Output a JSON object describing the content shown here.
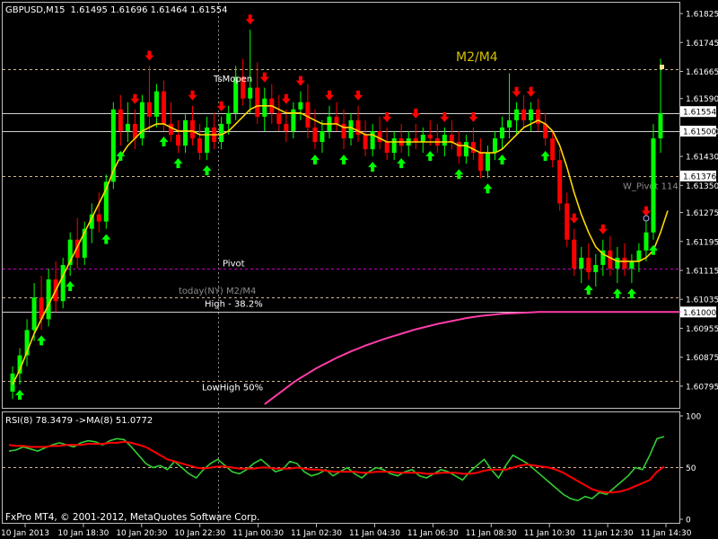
{
  "header": {
    "symbol": "GBPUSD,M15",
    "ohlc": "1.61495 1.61696 1.61464 1.61554"
  },
  "footer": {
    "copyright": "FxPro MT4, © 2001-2012, MetaQuotes Software Corp."
  },
  "colors": {
    "background": "#000000",
    "bull": "#00ff00",
    "bear": "#ff0000",
    "ma_fast": "#ffd700",
    "ma_slow": "#ff3da8",
    "rsi_line": "#32cd32",
    "rsi_ma": "#ff0000",
    "pivot": "#c000c0",
    "level": "#d2b48c",
    "white_line": "#d0d0d0",
    "axis_text": "#ffffff"
  },
  "chart_data": {
    "type": "candlestick",
    "x_ticks": [
      "10 Jan 2013",
      "10 Jan 18:30",
      "10 Jan 20:30",
      "10 Jan 22:30",
      "11 Jan 00:30",
      "11 Jan 02:30",
      "11 Jan 04:30",
      "11 Jan 06:30",
      "11 Jan 08:30",
      "11 Jan 10:30",
      "11 Jan 12:30",
      "11 Jan 14:30"
    ],
    "y_range": [
      1.6074,
      1.6185
    ],
    "y_ticks": [
      "1.61825",
      "1.61745",
      "1.61665",
      "1.61590",
      "1.61500",
      "1.61430",
      "1.61350",
      "1.61275",
      "1.61195",
      "1.61115",
      "1.61035",
      "1.60955",
      "1.60875",
      "1.60795"
    ],
    "price_tags": [
      {
        "label": "1.61554",
        "value": 1.61554
      },
      {
        "label": "1.61500",
        "value": 1.615
      },
      {
        "label": "1.61376",
        "value": 1.61376
      },
      {
        "label": "1.61000",
        "value": 1.61
      }
    ],
    "hlines": [
      {
        "value": 1.6167,
        "style": "level",
        "label": "M2/M4"
      },
      {
        "value": 1.6155,
        "style": "white",
        "label": ""
      },
      {
        "value": 1.615,
        "style": "white",
        "label": ""
      },
      {
        "value": 1.61376,
        "style": "level",
        "label": "W_Pivot 114"
      },
      {
        "value": 1.6112,
        "style": "pivot",
        "label": "Pivot"
      },
      {
        "value": 1.6104,
        "style": "level",
        "label": "High - 38.2%"
      },
      {
        "value": 1.61,
        "style": "white",
        "label": ""
      },
      {
        "value": 1.6081,
        "style": "level",
        "label": "LowHigh 50%"
      }
    ],
    "annotations": [
      {
        "text": "M2/M4",
        "color": "#d4c000"
      },
      {
        "text": "TsMopen",
        "color": "#ffffff"
      },
      {
        "text": "today(NY) M2/M4",
        "color": "#8c8c8c"
      }
    ],
    "candles": [
      [
        1.6078,
        1.6085,
        1.6076,
        1.6083
      ],
      [
        1.6083,
        1.609,
        1.608,
        1.6088
      ],
      [
        1.6088,
        1.6098,
        1.6085,
        1.6095
      ],
      [
        1.6095,
        1.6108,
        1.6092,
        1.6104
      ],
      [
        1.6104,
        1.611,
        1.6095,
        1.6098
      ],
      [
        1.6098,
        1.6112,
        1.6096,
        1.6109
      ],
      [
        1.6109,
        1.6114,
        1.61,
        1.6103
      ],
      [
        1.6103,
        1.6115,
        1.6101,
        1.6113
      ],
      [
        1.6113,
        1.6122,
        1.611,
        1.612
      ],
      [
        1.612,
        1.6126,
        1.6112,
        1.6115
      ],
      [
        1.6115,
        1.6125,
        1.6113,
        1.6123
      ],
      [
        1.6123,
        1.613,
        1.6119,
        1.6127
      ],
      [
        1.6127,
        1.6133,
        1.6122,
        1.6125
      ],
      [
        1.6125,
        1.6138,
        1.6123,
        1.6136
      ],
      [
        1.6136,
        1.6158,
        1.6134,
        1.6156
      ],
      [
        1.6156,
        1.616,
        1.6146,
        1.615
      ],
      [
        1.615,
        1.6158,
        1.6147,
        1.6152
      ],
      [
        1.6152,
        1.6156,
        1.6145,
        1.6148
      ],
      [
        1.6148,
        1.616,
        1.6146,
        1.6158
      ],
      [
        1.6158,
        1.6168,
        1.615,
        1.6154
      ],
      [
        1.6154,
        1.6163,
        1.6151,
        1.6161
      ],
      [
        1.6161,
        1.6164,
        1.615,
        1.6152
      ],
      [
        1.6152,
        1.6158,
        1.6147,
        1.6149
      ],
      [
        1.6149,
        1.6153,
        1.6144,
        1.6146
      ],
      [
        1.6146,
        1.6155,
        1.6144,
        1.6153
      ],
      [
        1.6153,
        1.6157,
        1.6146,
        1.6148
      ],
      [
        1.6148,
        1.6152,
        1.6142,
        1.6144
      ],
      [
        1.6144,
        1.6154,
        1.6142,
        1.6151
      ],
      [
        1.6151,
        1.6155,
        1.6145,
        1.6147
      ],
      [
        1.6147,
        1.6154,
        1.6145,
        1.6152
      ],
      [
        1.6152,
        1.6157,
        1.6149,
        1.6155
      ],
      [
        1.6155,
        1.6168,
        1.6153,
        1.6165
      ],
      [
        1.6165,
        1.617,
        1.6157,
        1.6159
      ],
      [
        1.6159,
        1.6178,
        1.6155,
        1.6162
      ],
      [
        1.6162,
        1.6169,
        1.6152,
        1.6154
      ],
      [
        1.6154,
        1.6162,
        1.615,
        1.6159
      ],
      [
        1.6159,
        1.6163,
        1.6152,
        1.6155
      ],
      [
        1.6155,
        1.616,
        1.615,
        1.6152
      ],
      [
        1.6152,
        1.6156,
        1.6147,
        1.615
      ],
      [
        1.615,
        1.6158,
        1.6148,
        1.6156
      ],
      [
        1.6156,
        1.6161,
        1.6153,
        1.6158
      ],
      [
        1.6158,
        1.6163,
        1.6148,
        1.6151
      ],
      [
        1.6151,
        1.6156,
        1.6145,
        1.6147
      ],
      [
        1.6147,
        1.6153,
        1.6144,
        1.615
      ],
      [
        1.615,
        1.6157,
        1.6148,
        1.6154
      ],
      [
        1.6154,
        1.6158,
        1.615,
        1.6152
      ],
      [
        1.6152,
        1.6156,
        1.6145,
        1.6148
      ],
      [
        1.6148,
        1.6155,
        1.6146,
        1.6153
      ],
      [
        1.6153,
        1.6157,
        1.6147,
        1.6149
      ],
      [
        1.6149,
        1.6153,
        1.6143,
        1.6145
      ],
      [
        1.6145,
        1.6152,
        1.6143,
        1.615
      ],
      [
        1.615,
        1.6154,
        1.6145,
        1.6147
      ],
      [
        1.6147,
        1.6151,
        1.6142,
        1.6144
      ],
      [
        1.6144,
        1.615,
        1.6142,
        1.6148
      ],
      [
        1.6148,
        1.6152,
        1.6144,
        1.6146
      ],
      [
        1.6146,
        1.615,
        1.6143,
        1.6148
      ],
      [
        1.6148,
        1.6152,
        1.6145,
        1.6147
      ],
      [
        1.6147,
        1.6151,
        1.6144,
        1.6149
      ],
      [
        1.6149,
        1.6153,
        1.6146,
        1.6148
      ],
      [
        1.6148,
        1.6152,
        1.6144,
        1.6146
      ],
      [
        1.6146,
        1.6151,
        1.6143,
        1.6149
      ],
      [
        1.6149,
        1.6153,
        1.6145,
        1.6147
      ],
      [
        1.6147,
        1.615,
        1.6141,
        1.6143
      ],
      [
        1.6143,
        1.6149,
        1.6141,
        1.6147
      ],
      [
        1.6147,
        1.6151,
        1.6142,
        1.6144
      ],
      [
        1.6144,
        1.6148,
        1.6137,
        1.6139
      ],
      [
        1.6139,
        1.6146,
        1.6137,
        1.6144
      ],
      [
        1.6144,
        1.615,
        1.6142,
        1.6148
      ],
      [
        1.6148,
        1.6154,
        1.6145,
        1.6151
      ],
      [
        1.6151,
        1.6166,
        1.6148,
        1.6153
      ],
      [
        1.6153,
        1.6158,
        1.6149,
        1.6156
      ],
      [
        1.6156,
        1.616,
        1.6151,
        1.6153
      ],
      [
        1.6153,
        1.6158,
        1.615,
        1.6156
      ],
      [
        1.6156,
        1.6159,
        1.615,
        1.6152
      ],
      [
        1.6152,
        1.6155,
        1.6146,
        1.6148
      ],
      [
        1.6148,
        1.615,
        1.614,
        1.6142
      ],
      [
        1.6142,
        1.6145,
        1.6128,
        1.613
      ],
      [
        1.613,
        1.6133,
        1.6118,
        1.612
      ],
      [
        1.612,
        1.6123,
        1.611,
        1.6112
      ],
      [
        1.6112,
        1.6118,
        1.6108,
        1.6115
      ],
      [
        1.6115,
        1.6119,
        1.6109,
        1.6111
      ],
      [
        1.6111,
        1.6116,
        1.6107,
        1.6113
      ],
      [
        1.6113,
        1.612,
        1.611,
        1.6117
      ],
      [
        1.6117,
        1.6121,
        1.611,
        1.6112
      ],
      [
        1.6112,
        1.6118,
        1.6108,
        1.6115
      ],
      [
        1.6115,
        1.6119,
        1.611,
        1.6112
      ],
      [
        1.6112,
        1.6116,
        1.6108,
        1.6114
      ],
      [
        1.6114,
        1.6119,
        1.6111,
        1.6117
      ],
      [
        1.6117,
        1.6125,
        1.6114,
        1.6122
      ],
      [
        1.6122,
        1.6152,
        1.612,
        1.6148
      ],
      [
        1.6148,
        1.617,
        1.6144,
        1.6155
      ]
    ],
    "ma_fast": [
      1.608,
      1.6084,
      1.6089,
      1.6094,
      1.6098,
      1.6102,
      1.6106,
      1.611,
      1.6114,
      1.6118,
      1.6122,
      1.6126,
      1.613,
      1.6134,
      1.6139,
      1.6143,
      1.6146,
      1.6148,
      1.615,
      1.6151,
      1.6152,
      1.6152,
      1.6151,
      1.615,
      1.615,
      1.615,
      1.6149,
      1.6149,
      1.6149,
      1.6149,
      1.615,
      1.6152,
      1.6154,
      1.6156,
      1.6157,
      1.6157,
      1.6157,
      1.6156,
      1.6155,
      1.6155,
      1.6155,
      1.6154,
      1.6153,
      1.6152,
      1.6152,
      1.6152,
      1.6151,
      1.6151,
      1.615,
      1.6149,
      1.6149,
      1.6148,
      1.6147,
      1.6147,
      1.6147,
      1.6147,
      1.6147,
      1.6147,
      1.6147,
      1.6147,
      1.6147,
      1.6147,
      1.6146,
      1.6146,
      1.6145,
      1.6144,
      1.6144,
      1.6144,
      1.6145,
      1.6147,
      1.6149,
      1.6151,
      1.6152,
      1.6153,
      1.6152,
      1.615,
      1.6146,
      1.614,
      1.6133,
      1.6127,
      1.6122,
      1.6118,
      1.6116,
      1.6115,
      1.6114,
      1.6114,
      1.6114,
      1.6114,
      1.6115,
      1.6117,
      1.6122,
      1.6128
    ],
    "ma_slow": [
      null,
      null,
      null,
      null,
      null,
      null,
      null,
      null,
      null,
      null,
      null,
      null,
      null,
      null,
      null,
      null,
      null,
      null,
      null,
      null,
      null,
      null,
      null,
      null,
      null,
      null,
      null,
      null,
      null,
      null,
      null,
      null,
      null,
      null,
      null,
      1.60745,
      1.6076,
      1.60775,
      1.6079,
      1.60805,
      1.60818,
      1.6083,
      1.60842,
      1.60853,
      1.60863,
      1.60873,
      1.60882,
      1.60891,
      1.60899,
      1.60907,
      1.60914,
      1.60921,
      1.60928,
      1.60934,
      1.6094,
      1.60946,
      1.60952,
      1.60957,
      1.60962,
      1.60967,
      1.60971,
      1.60975,
      1.60979,
      1.60983,
      1.60986,
      1.60989,
      1.60991,
      1.60993,
      1.60995,
      1.60996,
      1.60997,
      1.60998,
      1.60999,
      1.61,
      1.61,
      1.61,
      1.61,
      1.61,
      1.61,
      1.61,
      1.61,
      1.61,
      1.61,
      1.61,
      1.61,
      1.61,
      1.61,
      1.61,
      1.61,
      1.61,
      1.61,
      1.61,
      1.61,
      1.61
    ],
    "signals": [
      {
        "i": 1,
        "dir": "up"
      },
      {
        "i": 4,
        "dir": "up"
      },
      {
        "i": 8,
        "dir": "up"
      },
      {
        "i": 13,
        "dir": "up"
      },
      {
        "i": 15,
        "dir": "up"
      },
      {
        "i": 17,
        "dir": "down"
      },
      {
        "i": 19,
        "dir": "down"
      },
      {
        "i": 21,
        "dir": "up"
      },
      {
        "i": 23,
        "dir": "up"
      },
      {
        "i": 25,
        "dir": "down"
      },
      {
        "i": 27,
        "dir": "up"
      },
      {
        "i": 29,
        "dir": "down"
      },
      {
        "i": 33,
        "dir": "down"
      },
      {
        "i": 35,
        "dir": "down"
      },
      {
        "i": 38,
        "dir": "down"
      },
      {
        "i": 40,
        "dir": "down"
      },
      {
        "i": 42,
        "dir": "up"
      },
      {
        "i": 44,
        "dir": "down"
      },
      {
        "i": 46,
        "dir": "up"
      },
      {
        "i": 48,
        "dir": "down"
      },
      {
        "i": 50,
        "dir": "up"
      },
      {
        "i": 52,
        "dir": "down"
      },
      {
        "i": 54,
        "dir": "up"
      },
      {
        "i": 56,
        "dir": "down"
      },
      {
        "i": 58,
        "dir": "up"
      },
      {
        "i": 60,
        "dir": "down"
      },
      {
        "i": 62,
        "dir": "up"
      },
      {
        "i": 64,
        "dir": "down"
      },
      {
        "i": 66,
        "dir": "up"
      },
      {
        "i": 68,
        "dir": "up"
      },
      {
        "i": 70,
        "dir": "down"
      },
      {
        "i": 72,
        "dir": "down"
      },
      {
        "i": 74,
        "dir": "up"
      },
      {
        "i": 78,
        "dir": "down"
      },
      {
        "i": 80,
        "dir": "up"
      },
      {
        "i": 82,
        "dir": "down"
      },
      {
        "i": 84,
        "dir": "up"
      },
      {
        "i": 86,
        "dir": "up"
      },
      {
        "i": 88,
        "dir": "down"
      },
      {
        "i": 89,
        "dir": "up"
      },
      {
        "i": 91,
        "dir": "up"
      }
    ],
    "rsi": {
      "label": "RSI(8) 78.3479  ->MA(8) 51.0772",
      "y_range": [
        0,
        100
      ],
      "y_ticks": [
        "100",
        "50",
        "0"
      ],
      "level": 50,
      "values": [
        66,
        67,
        70,
        68,
        66,
        69,
        72,
        74,
        72,
        70,
        74,
        76,
        75,
        72,
        76,
        78,
        77,
        70,
        62,
        54,
        50,
        52,
        48,
        56,
        50,
        44,
        40,
        48,
        54,
        58,
        52,
        46,
        44,
        48,
        54,
        58,
        52,
        46,
        48,
        56,
        54,
        46,
        42,
        44,
        48,
        42,
        46,
        50,
        44,
        40,
        46,
        50,
        48,
        44,
        42,
        46,
        48,
        42,
        40,
        44,
        48,
        46,
        42,
        38,
        46,
        52,
        58,
        48,
        40,
        52,
        62,
        58,
        54,
        48,
        42,
        36,
        30,
        24,
        20,
        18,
        22,
        20,
        26,
        24,
        30,
        36,
        42,
        50,
        48,
        62,
        78,
        80
      ],
      "ma": [
        72,
        71,
        71,
        70,
        70,
        70,
        71,
        71,
        72,
        72,
        72,
        73,
        73,
        73,
        74,
        74,
        75,
        74,
        72,
        70,
        66,
        62,
        58,
        56,
        54,
        52,
        50,
        49,
        50,
        51,
        51,
        50,
        49,
        49,
        49,
        50,
        50,
        49,
        49,
        49,
        50,
        49,
        48,
        48,
        47,
        46,
        46,
        46,
        46,
        45,
        45,
        46,
        46,
        46,
        45,
        45,
        45,
        45,
        44,
        44,
        45,
        45,
        45,
        44,
        44,
        45,
        47,
        48,
        48,
        48,
        50,
        52,
        53,
        52,
        51,
        50,
        48,
        45,
        41,
        37,
        33,
        29,
        27,
        26,
        26,
        27,
        29,
        32,
        35,
        38,
        46,
        51
      ]
    }
  }
}
